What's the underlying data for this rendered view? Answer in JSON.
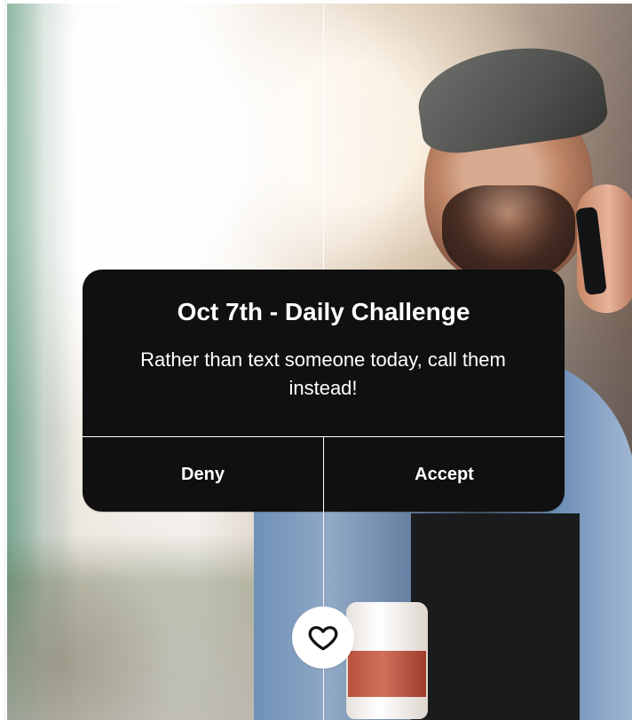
{
  "dialog": {
    "title": "Oct 7th - Daily Challenge",
    "message": "Rather than text someone today, call them instead!",
    "deny_label": "Deny",
    "accept_label": "Accept"
  },
  "actions": {
    "favorite_icon": "heart-icon"
  },
  "colors": {
    "dialog_background": "#101010",
    "dialog_text": "#ffffff",
    "favorite_button_background": "#ffffff",
    "heart_stroke": "#111111"
  }
}
